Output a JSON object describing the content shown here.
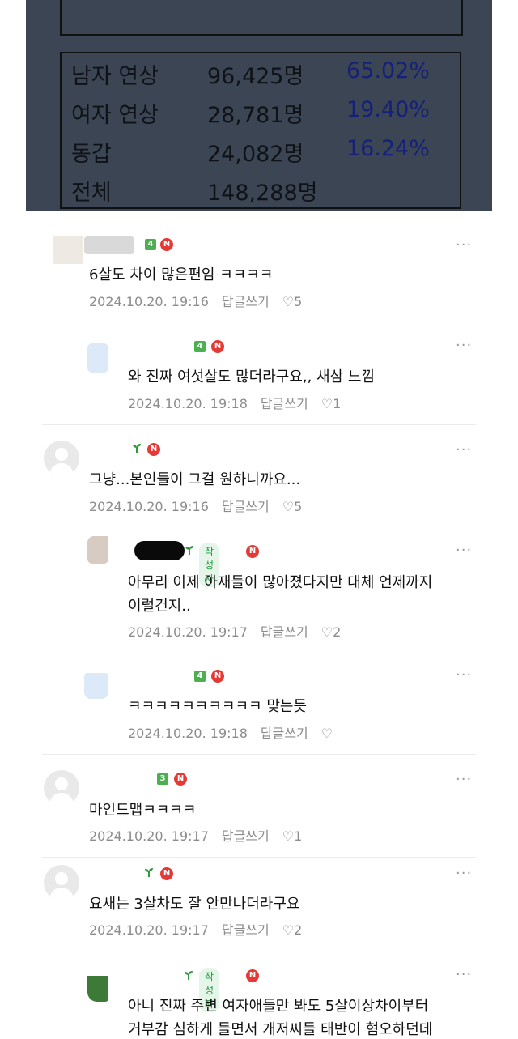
{
  "photo": {
    "rows": [
      {
        "label": "남자 연상",
        "count": "96,425명",
        "pct": "65.02%"
      },
      {
        "label": "여자 연상",
        "count": "28,781명",
        "pct": "19.40%"
      },
      {
        "label": "동갑",
        "count": "24,082명",
        "pct": "16.24%"
      },
      {
        "label": "전체",
        "count": "148,288명",
        "pct": ""
      }
    ]
  },
  "comments": [
    {
      "level": "4",
      "text": "6살도 차이 많은편임 ㅋㅋㅋㅋ",
      "date": "2024.10.20. 19:16",
      "reply": "답글쓰기",
      "likes": "5"
    },
    {
      "level": "4",
      "text": "와 진짜 여섯살도 많더라구요,, 새삼 느낌",
      "date": "2024.10.20. 19:18",
      "reply": "답글쓰기",
      "likes": "1"
    },
    {
      "level": "",
      "text": "그냥...본인들이 그걸 원하니까요...",
      "date": "2024.10.20. 19:16",
      "reply": "답글쓰기",
      "likes": "5"
    },
    {
      "level": "",
      "author_tag": "작성자",
      "text1": "아무리 이제 아재들이 많아졌다지만 대체 언제까지",
      "text2": "이럴건지..",
      "date": "2024.10.20. 19:17",
      "reply": "답글쓰기",
      "likes": "2"
    },
    {
      "level": "4",
      "text": "ㅋㅋㅋㅋㅋㅋㅋㅋㅋㅋ 맞는듯",
      "date": "2024.10.20. 19:18",
      "reply": "답글쓰기",
      "likes": ""
    },
    {
      "level": "3",
      "text": "마인드맵ㅋㅋㅋㅋ",
      "date": "2024.10.20. 19:17",
      "reply": "답글쓰기",
      "likes": "1"
    },
    {
      "level": "",
      "text": "요새는 3살차도 잘 안만나더라구요",
      "date": "2024.10.20. 19:17",
      "reply": "답글쓰기",
      "likes": "2"
    },
    {
      "level": "",
      "author_tag": "작성자",
      "text1": "아니 진짜 주변 여자애들만 봐도 5살이상차이부터",
      "text2": "거부감 심하게 들면서 개저씨들 태반이 혐오하던데"
    }
  ],
  "icons": {
    "more": "···",
    "heart": "♡",
    "new_badge": "N",
    "sprout": "sprout-icon"
  },
  "colors": {
    "level_badge": "#4caf50",
    "new_badge": "#e53935",
    "author_tag_text": "#1f9c3b",
    "pct_text": "#14207a"
  }
}
